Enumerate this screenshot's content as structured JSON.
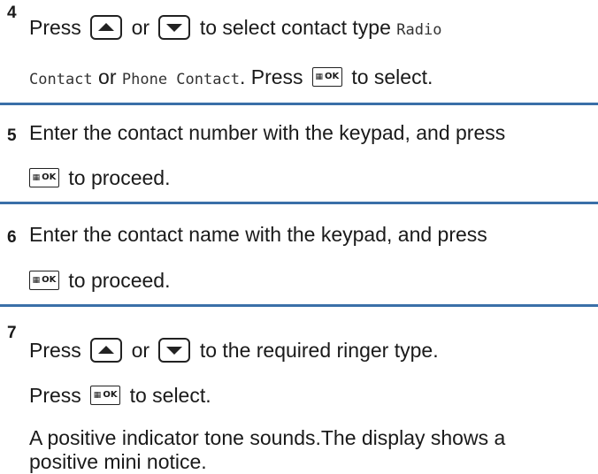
{
  "ok_key_text": "OK",
  "ok_key_grid": "▦",
  "steps": [
    {
      "number": "4",
      "press": "Press",
      "or": "or",
      "text_a": "to select contact type",
      "radio_contact": "Radio Contact",
      "or2": "or",
      "phone_contact": "Phone Contact",
      "period_press": ". Press",
      "to_select": "to select."
    },
    {
      "number": "5",
      "line1": "Enter the contact number with the keypad, and press",
      "to_proceed": "to proceed."
    },
    {
      "number": "6",
      "line1": "Enter the contact name with the keypad, and press",
      "to_proceed": "to proceed."
    },
    {
      "number": "7",
      "press": "Press",
      "or": "or",
      "text_a": "to the required ringer type.",
      "press2": "Press",
      "to_select": "to select.",
      "result_line1": "A positive indicator tone sounds.The display shows a",
      "result_line2": "positive mini notice."
    }
  ]
}
